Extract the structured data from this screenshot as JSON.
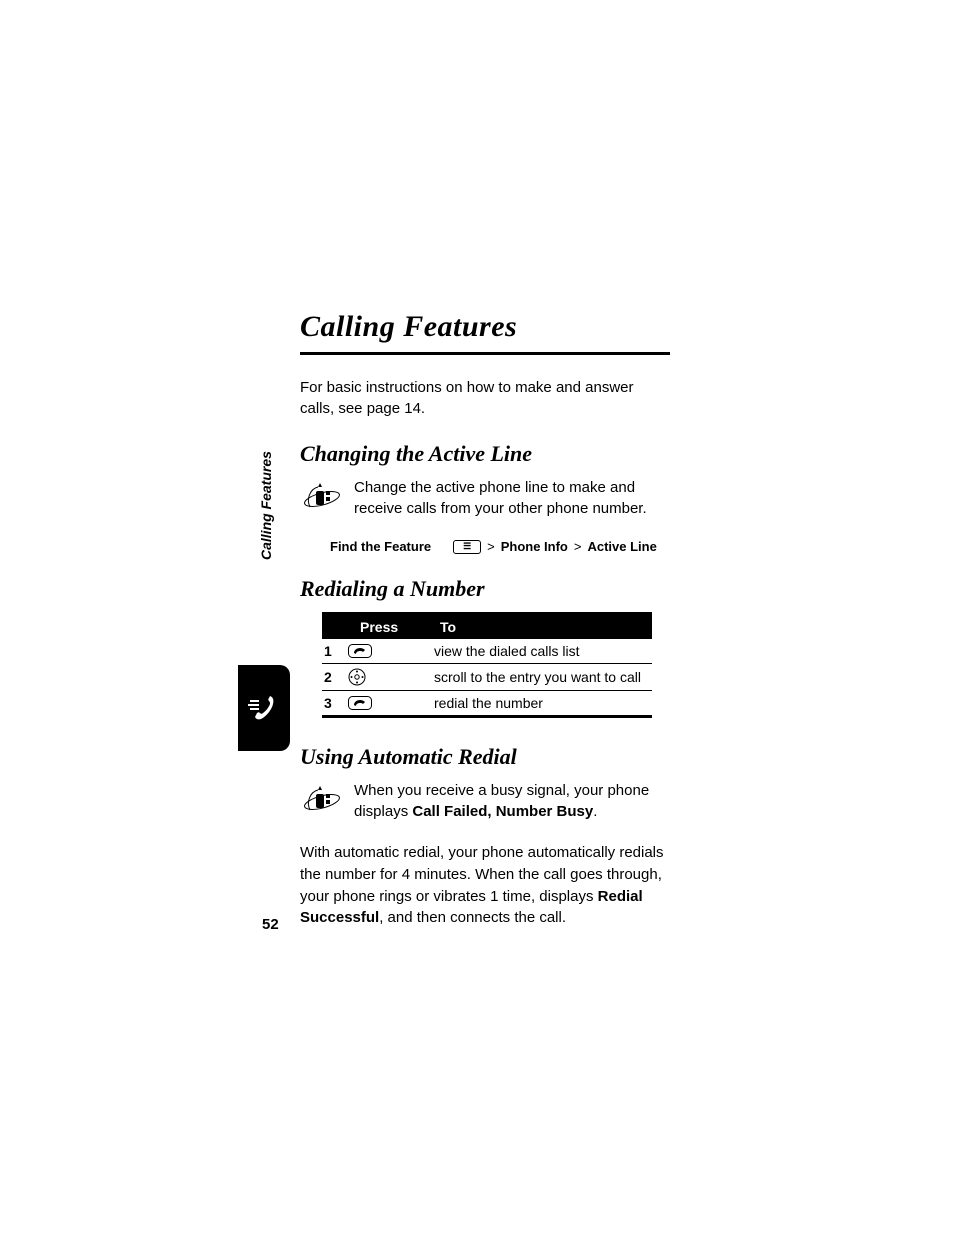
{
  "page": {
    "chapter_title": "Calling Features",
    "intro": "For basic instructions on how to make and answer calls, see page 14.",
    "sidebar_label": "Calling Features",
    "page_number": "52"
  },
  "section_changing": {
    "title": "Changing the Active Line",
    "body": "Change the active phone line to make and receive calls from your other phone number.",
    "find_label": "Find the Feature",
    "menu_key": "☰",
    "path_sep": ">",
    "path_a": "Phone Info",
    "path_b": "Active Line"
  },
  "section_redial": {
    "title": "Redialing a Number",
    "table": {
      "head_press": "Press",
      "head_to": "To",
      "rows": [
        {
          "num": "1",
          "icon": "send",
          "to": "view the dialed calls list"
        },
        {
          "num": "2",
          "icon": "nav",
          "to": "scroll to the entry you want to call"
        },
        {
          "num": "3",
          "icon": "send",
          "to": "redial the number"
        }
      ]
    }
  },
  "section_auto": {
    "title": "Using Automatic Redial",
    "line1_a": "When you receive a busy signal, your phone displays ",
    "line1_b": "Call Failed, Number Busy",
    "line1_c": ".",
    "line2_a": "With automatic redial, your phone automatically redials the number for 4 minutes. When the call goes through, your phone rings or vibrates 1 time, displays ",
    "line2_b": "Redial Successful",
    "line2_c": ", and then connects the call."
  }
}
